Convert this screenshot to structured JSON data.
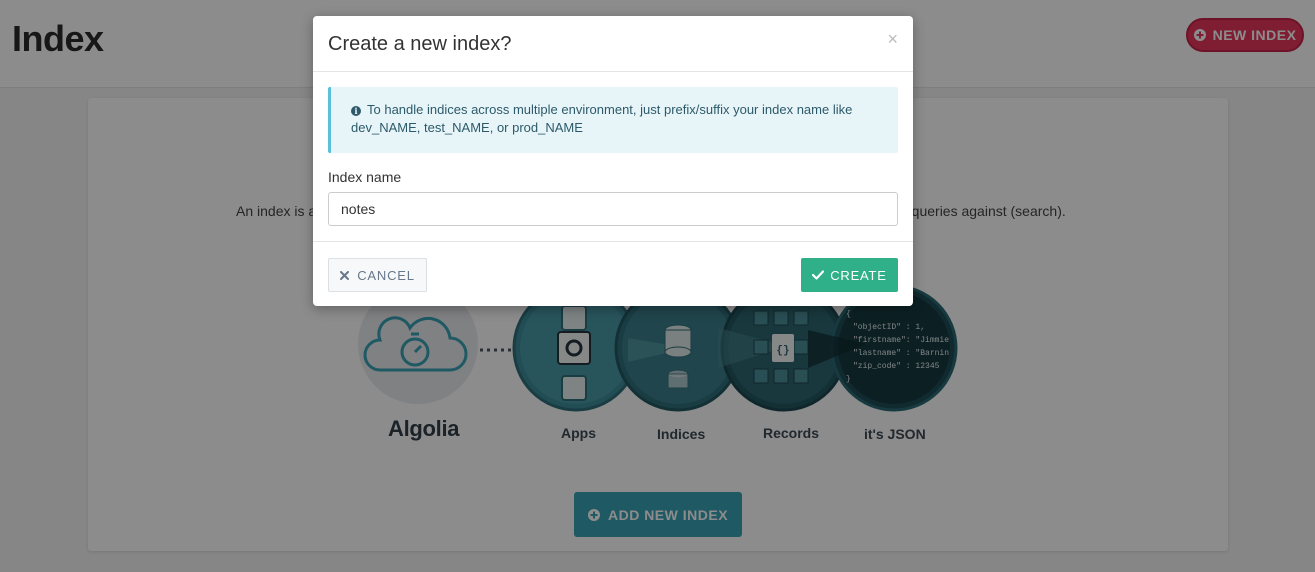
{
  "header": {
    "title": "Index",
    "new_index_button": "NEW INDEX"
  },
  "card": {
    "intro_left": "An index is a",
    "intro_right": "n queries against (search).",
    "diagram": {
      "labels": [
        "Algolia",
        "Apps",
        "Indices",
        "Records",
        "it's JSON"
      ],
      "json_lines": [
        "{",
        "\"objectID\" : 1,",
        "\"firstname\": \"Jimmie",
        "\"lastname\" : \"Barnin",
        "\"zip_code\" : 12345",
        "}"
      ]
    },
    "add_button": "ADD NEW INDEX"
  },
  "modal": {
    "title": "Create a new index?",
    "close_glyph": "×",
    "info_text": "To handle indices across multiple environment, just prefix/suffix your index name like dev_NAME, test_NAME, or prod_NAME",
    "field_label": "Index name",
    "field_value": "notes",
    "cancel_label": "CANCEL",
    "create_label": "CREATE"
  },
  "colors": {
    "brand_red": "#e8385d",
    "teal": "#3aa3b5",
    "success": "#2fb088",
    "info_bg": "#e8f5f8"
  }
}
